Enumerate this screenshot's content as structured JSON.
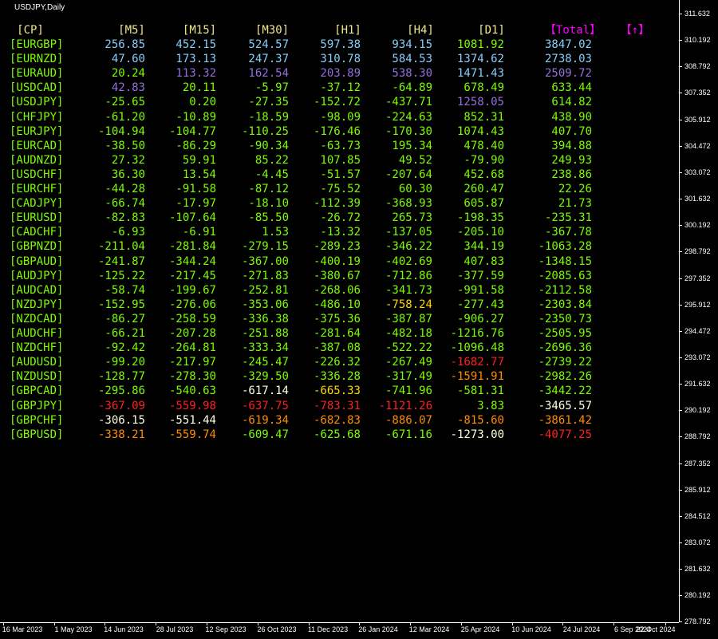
{
  "title": "USDJPY,Daily",
  "colors": {
    "background": "#000000",
    "header": "#F0E68C",
    "total_header": "#FF00FF",
    "pair": "#7CFC00",
    "positive_strong": "#87CEFA",
    "positive_purple": "#9370DB",
    "positive": "#7CFC00",
    "negative": "#7CFC00",
    "warn": "#FFD700",
    "alert": "#FF8C00",
    "danger": "#FF2020",
    "axis_text": "#FFFFFF"
  },
  "headers": [
    "[CP]",
    "[M5]",
    "[M15]",
    "[M30]",
    "[H1]",
    "[H4]",
    "[D1]",
    "【Total】",
    "【↑】"
  ],
  "header_colors": [
    "#F0E68C",
    "#F0E68C",
    "#F0E68C",
    "#F0E68C",
    "#F0E68C",
    "#F0E68C",
    "#F0E68C",
    "#FF00FF",
    "#FF00FF"
  ],
  "rows": [
    {
      "pair": "[EURGBP]",
      "values": [
        "256.85",
        "452.15",
        "524.57",
        "597.38",
        "934.15",
        "1081.92",
        "3847.02"
      ],
      "colors": [
        "#87CEFA",
        "#87CEFA",
        "#87CEFA",
        "#87CEFA",
        "#87CEFA",
        "#7CFC00",
        "#87CEFA"
      ]
    },
    {
      "pair": "[EURNZD]",
      "values": [
        "47.60",
        "173.13",
        "247.37",
        "310.78",
        "584.53",
        "1374.62",
        "2738.03"
      ],
      "colors": [
        "#87CEFA",
        "#87CEFA",
        "#87CEFA",
        "#87CEFA",
        "#87CEFA",
        "#87CEFA",
        "#87CEFA"
      ]
    },
    {
      "pair": "[EURAUD]",
      "values": [
        "20.24",
        "113.32",
        "162.54",
        "203.89",
        "538.30",
        "1471.43",
        "2509.72"
      ],
      "colors": [
        "#7CFC00",
        "#9370DB",
        "#9370DB",
        "#9370DB",
        "#9370DB",
        "#87CEFA",
        "#9370DB"
      ]
    },
    {
      "pair": "[USDCAD]",
      "values": [
        "42.83",
        "20.11",
        "-5.97",
        "-37.12",
        "-64.89",
        "678.49",
        "633.44"
      ],
      "colors": [
        "#9370DB",
        "#7CFC00",
        "#7CFC00",
        "#7CFC00",
        "#7CFC00",
        "#7CFC00",
        "#7CFC00"
      ]
    },
    {
      "pair": "[USDJPY]",
      "values": [
        "-25.65",
        "0.20",
        "-27.35",
        "-152.72",
        "-437.71",
        "1258.05",
        "614.82"
      ],
      "colors": [
        "#7CFC00",
        "#7CFC00",
        "#7CFC00",
        "#7CFC00",
        "#7CFC00",
        "#9370DB",
        "#7CFC00"
      ]
    },
    {
      "pair": "[CHFJPY]",
      "values": [
        "-61.20",
        "-10.89",
        "-18.59",
        "-98.09",
        "-224.63",
        "852.31",
        "438.90"
      ],
      "colors": [
        "#7CFC00",
        "#7CFC00",
        "#7CFC00",
        "#7CFC00",
        "#7CFC00",
        "#7CFC00",
        "#7CFC00"
      ]
    },
    {
      "pair": "[EURJPY]",
      "values": [
        "-104.94",
        "-104.77",
        "-110.25",
        "-176.46",
        "-170.30",
        "1074.43",
        "407.70"
      ],
      "colors": [
        "#7CFC00",
        "#7CFC00",
        "#7CFC00",
        "#7CFC00",
        "#7CFC00",
        "#7CFC00",
        "#7CFC00"
      ]
    },
    {
      "pair": "[EURCAD]",
      "values": [
        "-38.50",
        "-86.29",
        "-90.34",
        "-63.73",
        "195.34",
        "478.40",
        "394.88"
      ],
      "colors": [
        "#7CFC00",
        "#7CFC00",
        "#7CFC00",
        "#7CFC00",
        "#7CFC00",
        "#7CFC00",
        "#7CFC00"
      ]
    },
    {
      "pair": "[AUDNZD]",
      "values": [
        "27.32",
        "59.91",
        "85.22",
        "107.85",
        "49.52",
        "-79.90",
        "249.93"
      ],
      "colors": [
        "#7CFC00",
        "#7CFC00",
        "#7CFC00",
        "#7CFC00",
        "#7CFC00",
        "#7CFC00",
        "#7CFC00"
      ]
    },
    {
      "pair": "[USDCHF]",
      "values": [
        "36.30",
        "13.54",
        "-4.45",
        "-51.57",
        "-207.64",
        "452.68",
        "238.86"
      ],
      "colors": [
        "#7CFC00",
        "#7CFC00",
        "#7CFC00",
        "#7CFC00",
        "#7CFC00",
        "#7CFC00",
        "#7CFC00"
      ]
    },
    {
      "pair": "[EURCHF]",
      "values": [
        "-44.28",
        "-91.58",
        "-87.12",
        "-75.52",
        "60.30",
        "260.47",
        "22.26"
      ],
      "colors": [
        "#7CFC00",
        "#7CFC00",
        "#7CFC00",
        "#7CFC00",
        "#7CFC00",
        "#7CFC00",
        "#7CFC00"
      ]
    },
    {
      "pair": "[CADJPY]",
      "values": [
        "-66.74",
        "-17.97",
        "-18.10",
        "-112.39",
        "-368.93",
        "605.87",
        "21.73"
      ],
      "colors": [
        "#7CFC00",
        "#7CFC00",
        "#7CFC00",
        "#7CFC00",
        "#7CFC00",
        "#7CFC00",
        "#7CFC00"
      ]
    },
    {
      "pair": "[EURUSD]",
      "values": [
        "-82.83",
        "-107.64",
        "-85.50",
        "-26.72",
        "265.73",
        "-198.35",
        "-235.31"
      ],
      "colors": [
        "#7CFC00",
        "#7CFC00",
        "#7CFC00",
        "#7CFC00",
        "#7CFC00",
        "#7CFC00",
        "#7CFC00"
      ]
    },
    {
      "pair": "[CADCHF]",
      "values": [
        "-6.93",
        "-6.91",
        "1.53",
        "-13.32",
        "-137.05",
        "-205.10",
        "-367.78"
      ],
      "colors": [
        "#7CFC00",
        "#7CFC00",
        "#7CFC00",
        "#7CFC00",
        "#7CFC00",
        "#7CFC00",
        "#7CFC00"
      ]
    },
    {
      "pair": "[GBPNZD]",
      "values": [
        "-211.04",
        "-281.84",
        "-279.15",
        "-289.23",
        "-346.22",
        "344.19",
        "-1063.28"
      ],
      "colors": [
        "#7CFC00",
        "#7CFC00",
        "#7CFC00",
        "#7CFC00",
        "#7CFC00",
        "#7CFC00",
        "#7CFC00"
      ]
    },
    {
      "pair": "[GBPAUD]",
      "values": [
        "-241.87",
        "-344.24",
        "-367.00",
        "-400.19",
        "-402.69",
        "407.83",
        "-1348.15"
      ],
      "colors": [
        "#7CFC00",
        "#7CFC00",
        "#7CFC00",
        "#7CFC00",
        "#7CFC00",
        "#7CFC00",
        "#7CFC00"
      ]
    },
    {
      "pair": "[AUDJPY]",
      "values": [
        "-125.22",
        "-217.45",
        "-271.83",
        "-380.67",
        "-712.86",
        "-377.59",
        "-2085.63"
      ],
      "colors": [
        "#7CFC00",
        "#7CFC00",
        "#7CFC00",
        "#7CFC00",
        "#7CFC00",
        "#7CFC00",
        "#7CFC00"
      ]
    },
    {
      "pair": "[AUDCAD]",
      "values": [
        "-58.74",
        "-199.67",
        "-252.81",
        "-268.06",
        "-341.73",
        "-991.58",
        "-2112.58"
      ],
      "colors": [
        "#7CFC00",
        "#7CFC00",
        "#7CFC00",
        "#7CFC00",
        "#7CFC00",
        "#7CFC00",
        "#7CFC00"
      ]
    },
    {
      "pair": "[NZDJPY]",
      "values": [
        "-152.95",
        "-276.06",
        "-353.06",
        "-486.10",
        "-758.24",
        "-277.43",
        "-2303.84"
      ],
      "colors": [
        "#7CFC00",
        "#7CFC00",
        "#7CFC00",
        "#7CFC00",
        "#FFD700",
        "#7CFC00",
        "#7CFC00"
      ]
    },
    {
      "pair": "[NZDCAD]",
      "values": [
        "-86.27",
        "-258.59",
        "-336.38",
        "-375.36",
        "-387.87",
        "-906.27",
        "-2350.73"
      ],
      "colors": [
        "#7CFC00",
        "#7CFC00",
        "#7CFC00",
        "#7CFC00",
        "#7CFC00",
        "#7CFC00",
        "#7CFC00"
      ]
    },
    {
      "pair": "[AUDCHF]",
      "values": [
        "-66.21",
        "-207.28",
        "-251.88",
        "-281.64",
        "-482.18",
        "-1216.76",
        "-2505.95"
      ],
      "colors": [
        "#7CFC00",
        "#7CFC00",
        "#7CFC00",
        "#7CFC00",
        "#7CFC00",
        "#7CFC00",
        "#7CFC00"
      ]
    },
    {
      "pair": "[NZDCHF]",
      "values": [
        "-92.42",
        "-264.81",
        "-333.34",
        "-387.08",
        "-522.22",
        "-1096.48",
        "-2696.36"
      ],
      "colors": [
        "#7CFC00",
        "#7CFC00",
        "#7CFC00",
        "#7CFC00",
        "#7CFC00",
        "#7CFC00",
        "#7CFC00"
      ]
    },
    {
      "pair": "[AUDUSD]",
      "values": [
        "-99.20",
        "-217.97",
        "-245.47",
        "-226.32",
        "-267.49",
        "-1682.77",
        "-2739.22"
      ],
      "colors": [
        "#7CFC00",
        "#7CFC00",
        "#7CFC00",
        "#7CFC00",
        "#7CFC00",
        "#FF2020",
        "#7CFC00"
      ]
    },
    {
      "pair": "[NZDUSD]",
      "values": [
        "-128.77",
        "-278.30",
        "-329.50",
        "-336.28",
        "-317.49",
        "-1591.91",
        "-2982.26"
      ],
      "colors": [
        "#7CFC00",
        "#7CFC00",
        "#7CFC00",
        "#7CFC00",
        "#7CFC00",
        "#FF8C00",
        "#7CFC00"
      ]
    },
    {
      "pair": "[GBPCAD]",
      "values": [
        "-295.86",
        "-540.63",
        "-617.14",
        "-665.33",
        "-741.96",
        "-581.31",
        "-3442.22"
      ],
      "colors": [
        "#7CFC00",
        "#7CFC00",
        "#FFFFE0",
        "#FFD700",
        "#7CFC00",
        "#7CFC00",
        "#7CFC00"
      ]
    },
    {
      "pair": "[GBPJPY]",
      "values": [
        "-367.09",
        "-559.98",
        "-637.75",
        "-783.31",
        "-1121.26",
        "3.83",
        "-3465.57"
      ],
      "colors": [
        "#FF2020",
        "#FF2020",
        "#FF2020",
        "#FF2020",
        "#FF2020",
        "#7CFC00",
        "#FFFFE0"
      ]
    },
    {
      "pair": "[GBPCHF]",
      "values": [
        "-306.15",
        "-551.44",
        "-619.34",
        "-682.83",
        "-886.07",
        "-815.60",
        "-3861.42"
      ],
      "colors": [
        "#FFFFE0",
        "#FFFFE0",
        "#FF8C00",
        "#FF8C00",
        "#FF8C00",
        "#FF8C00",
        "#FF8C00"
      ]
    },
    {
      "pair": "[GBPUSD]",
      "values": [
        "-338.21",
        "-559.74",
        "-609.47",
        "-625.68",
        "-671.16",
        "-1273.00",
        "-4077.25"
      ],
      "colors": [
        "#FF8C00",
        "#FF8C00",
        "#7CFC00",
        "#7CFC00",
        "#7CFC00",
        "#FFFFE0",
        "#FF2020"
      ]
    }
  ],
  "price_axis": [
    "311.632",
    "310.192",
    "308.792",
    "307.352",
    "305.912",
    "304.472",
    "303.072",
    "301.632",
    "300.192",
    "298.792",
    "297.352",
    "295.912",
    "294.472",
    "293.072",
    "291.632",
    "290.192",
    "288.792",
    "287.352",
    "285.912",
    "284.512",
    "283.072",
    "281.632",
    "280.192",
    "278.792"
  ],
  "time_axis": [
    "16 Mar 2023",
    "1 May 2023",
    "14 Jun 2023",
    "28 Jul 2023",
    "12 Sep 2023",
    "26 Oct 2023",
    "11 Dec 2023",
    "26 Jan 2024",
    "12 Mar 2024",
    "25 Apr 2024",
    "10 Jun 2024",
    "24 Jul 2024",
    "6 Sep 2024",
    "22 Oct 2024"
  ]
}
